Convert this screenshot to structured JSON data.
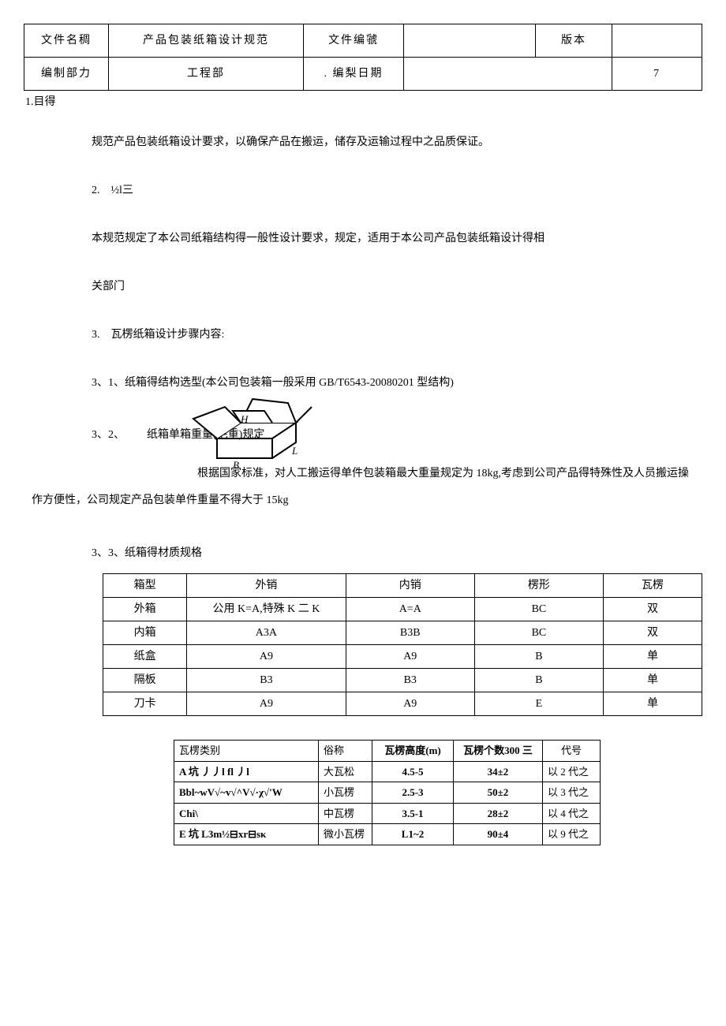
{
  "header": {
    "c1": "文件名稠",
    "c2": "产品包装纸箱设计规范",
    "c3": "文件编虢",
    "c4": "",
    "c5": "版本",
    "c6": "",
    "r2c1": "编制部力",
    "r2c2": "工程部",
    "r2c3": ". 编梨日期",
    "r2c4": "",
    "r2c5": "",
    "r2c6": "7"
  },
  "s1_heading": "1.目得",
  "s1_body": "规范产品包装纸箱设计要求，以确保产品在搬运，储存及运输过程中之品质保证。",
  "s2_heading": "2. ½l三",
  "s2_body1": "本规范规定了本公司纸箱结构得一般性设计要求，规定，适用于本公司产品包装纸箱设计得相",
  "s2_body2": "关部门",
  "s3_heading": "3. 瓦楞纸箱设计步骤内容:",
  "s31_heading": "3、1、纸箱得结构选型(本公司包装箱一般采用 GB/T6543-20080201 型结构)",
  "s32_heading": "3、2、  纸箱单箱重量(毛重)规定",
  "diagram": {
    "H": "H",
    "B": "B",
    "L": "L"
  },
  "s32_body": "根据国家标准，对人工搬运得单件包装箱最大重量规定为 18kg,考虑到公司产品得特殊性及人员搬运操作方便性，公司规定产品包装单件重量不得大于 15kg",
  "s33_heading": "3、3、纸箱得材质规格",
  "material": {
    "head": [
      "箱型",
      "外销",
      "内销",
      "楞形",
      "瓦楞"
    ],
    "rows": [
      [
        "外箱",
        "公用 K=A,特殊 K 二 K",
        "A=A",
        "BC",
        "双"
      ],
      [
        "内箱",
        "A3A",
        "B3B",
        "BC",
        "双"
      ],
      [
        "纸盒",
        "A9",
        "A9",
        "B",
        "单"
      ],
      [
        "隔板",
        "B3",
        "B3",
        "B",
        "单"
      ],
      [
        "刀卡",
        "A9",
        "A9",
        "E",
        "单"
      ]
    ]
  },
  "flute": {
    "head": [
      "瓦楞类别",
      "俗称",
      "瓦楞高度(m)",
      "瓦楞个数300 三",
      "代号"
    ],
    "rows": [
      [
        "A 坑 丿丿l fl 丿l",
        "大瓦松",
        "4.5-5",
        "34±2",
        "以 2 代之"
      ],
      [
        "Bbl~wV√~v√^V√·χ√'W",
        "小瓦楞",
        "2.5-3",
        "50±2",
        "以 3 代之"
      ],
      [
        "Chi\\",
        "中瓦楞",
        "3.5-1",
        "28±2",
        "以 4 代之"
      ],
      [
        "E 坑 L3m½⊟xr⊟sκ",
        "微小瓦楞",
        "L1~2",
        "90±4",
        "以 9 代之"
      ]
    ]
  }
}
